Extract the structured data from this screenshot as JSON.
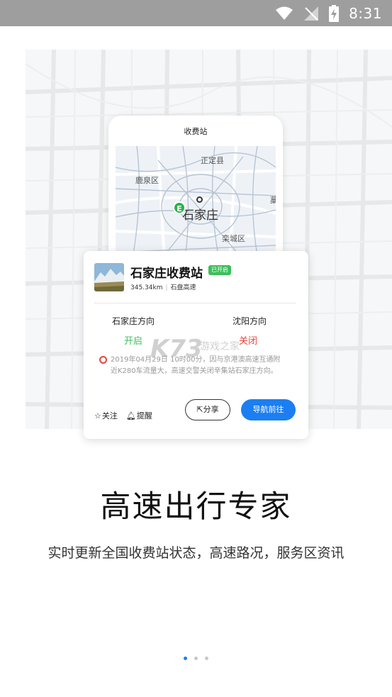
{
  "status_bar": {
    "time": "8:31"
  },
  "phone": {
    "title": "收费站",
    "map_labels": {
      "zhengding": "正定县",
      "luquan": "鹿泉区",
      "city": "石家庄",
      "luancheng": "栾城区",
      "edge": "藁"
    },
    "poi_marker": "E"
  },
  "card": {
    "station_name": "石家庄收费站",
    "badge": "已开启",
    "distance": "345.34km",
    "highway": "石盘高速",
    "direction_left": {
      "name": "石家庄方向",
      "state": "开启"
    },
    "direction_right": {
      "name": "沈阳方向",
      "state": "关闭"
    },
    "notice": "2019年04月29日 10时00分，因与京港澳高速互通附近K280车流量大，高速交警关闭辛集站石家庄方向。",
    "follow_label": "关注",
    "remind_label": "提醒",
    "share_label": "分享",
    "navigate_label": "导航前往"
  },
  "watermark": {
    "brand": "K73",
    "sub": "游戏之家"
  },
  "headline": "高速出行专家",
  "subline": "实时更新全国收费站状态，高速路况，服务区资讯",
  "pager": {
    "count": 3,
    "active": 0
  },
  "colors": {
    "accent": "#1b7ef2",
    "open": "#3cbf5b",
    "closed": "#e8453c",
    "statusbar": "#9e9e9e"
  }
}
